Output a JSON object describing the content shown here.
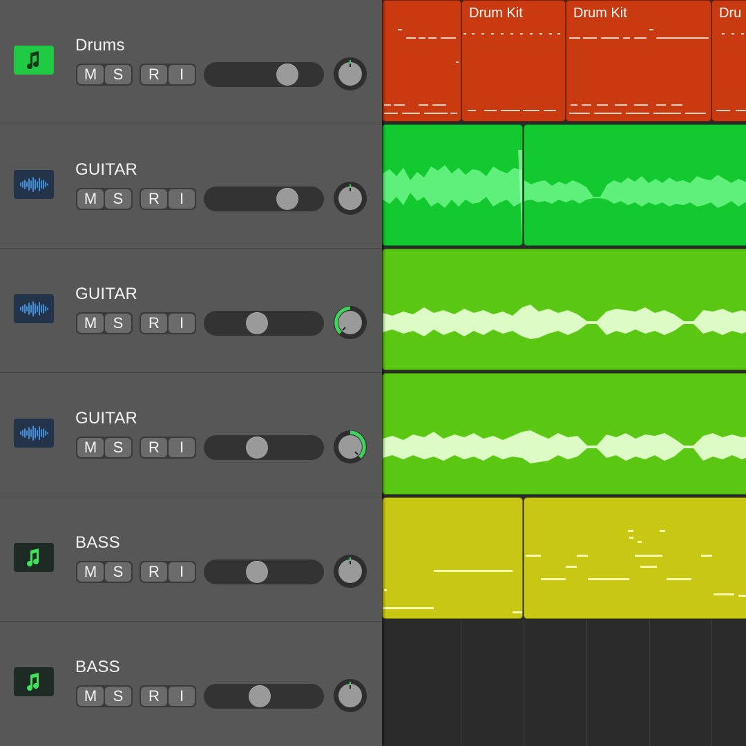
{
  "tracks": [
    {
      "name": "Drums",
      "icon": "music-note-icon",
      "icon_bg": "#20c943",
      "mute": "M",
      "solo": "S",
      "record": "R",
      "input": "I",
      "volume": 0.69,
      "pan_ring": "none"
    },
    {
      "name": "GUITAR",
      "icon": "waveform-icon",
      "icon_bg": "#23334a",
      "mute": "M",
      "solo": "S",
      "record": "R",
      "input": "I",
      "volume": 0.69,
      "pan_ring": "none"
    },
    {
      "name": "GUITAR",
      "icon": "waveform-icon",
      "icon_bg": "#23334a",
      "mute": "M",
      "solo": "S",
      "record": "R",
      "input": "I",
      "volume": 0.44,
      "pan_ring": "left"
    },
    {
      "name": "GUITAR",
      "icon": "waveform-icon",
      "icon_bg": "#23334a",
      "mute": "M",
      "solo": "S",
      "record": "R",
      "input": "I",
      "volume": 0.44,
      "pan_ring": "right"
    },
    {
      "name": "BASS",
      "icon": "music-note-icon",
      "icon_bg": "#1e2a24",
      "mute": "M",
      "solo": "S",
      "record": "R",
      "input": "I",
      "volume": 0.44,
      "pan_ring": "none"
    },
    {
      "name": "BASS",
      "icon": "music-note-icon",
      "icon_bg": "#1e2a24",
      "mute": "M",
      "solo": "S",
      "record": "R",
      "input": "I",
      "volume": 0.46,
      "pan_ring": "none"
    }
  ],
  "regions": {
    "drum_label_1": "Drum Kit",
    "drum_label_2": "Drum Kit",
    "drum_label_3": "Dru"
  },
  "colors": {
    "drums_region": "#c93a10",
    "guitar1_region": "#12c92f",
    "guitar2_region": "#5ac812",
    "bass_region": "#c8c814",
    "knob_ring": "#3fd45a",
    "pan_indicator": "#3fd45a"
  }
}
